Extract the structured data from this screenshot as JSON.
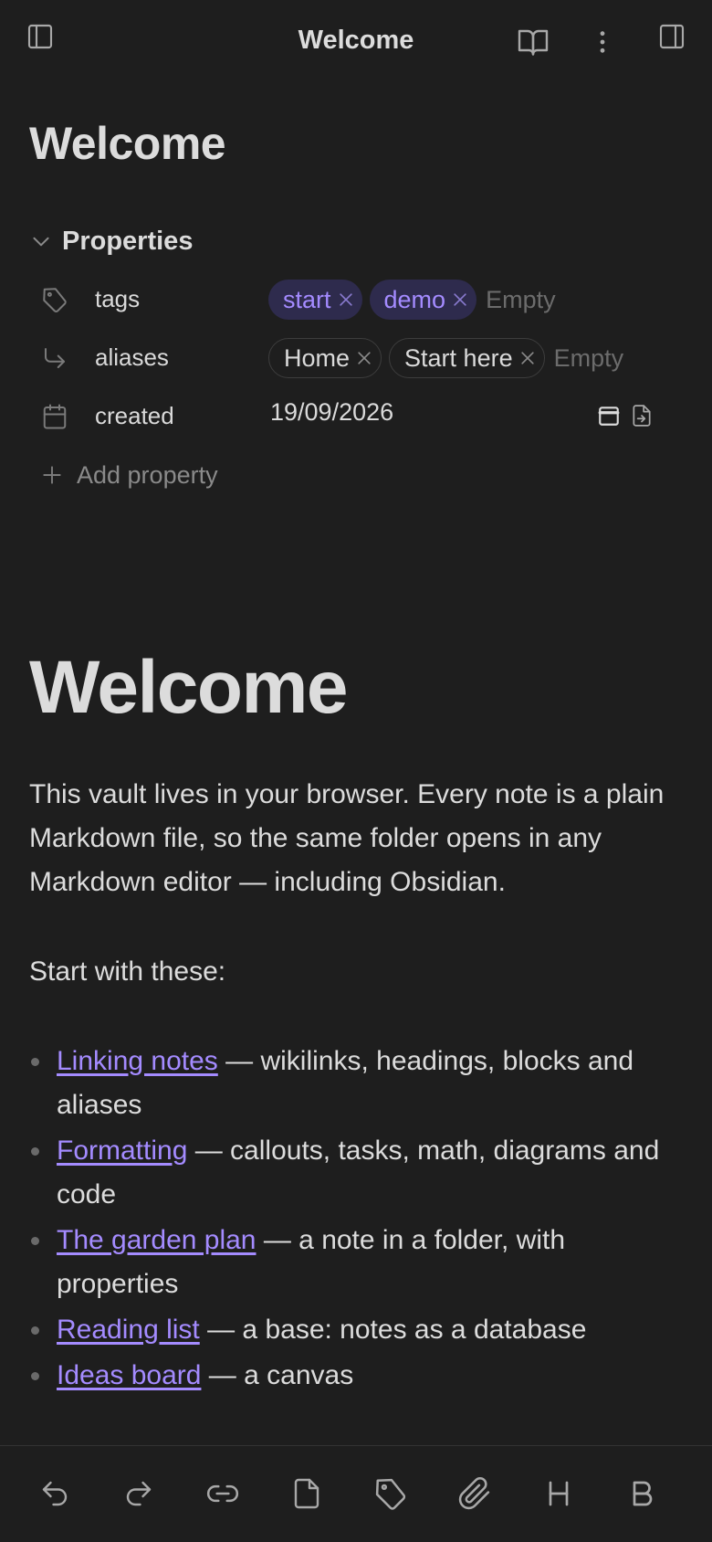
{
  "header": {
    "title": "Welcome",
    "left_icon": "sidebar-left-icon",
    "right_icons": [
      "book-open-icon",
      "more-vertical-icon",
      "sidebar-right-icon"
    ]
  },
  "note": {
    "title": "Welcome"
  },
  "properties": {
    "heading": "Properties",
    "tags": {
      "key": "tags",
      "values": [
        "start",
        "demo"
      ],
      "empty_placeholder": "Empty"
    },
    "aliases": {
      "key": "aliases",
      "values": [
        "Home",
        "Start here"
      ],
      "empty_placeholder": "Empty"
    },
    "created": {
      "key": "created",
      "value": "19/09/2026"
    },
    "add_label": "Add property"
  },
  "body": {
    "heading": "Welcome",
    "intro": "This vault lives in your browser. Every note is a plain Markdown file, so the same folder opens in any Markdown editor — including Obsidian.",
    "start_text": "Start with these:",
    "items": [
      {
        "link": "Linking notes",
        "text": " — wikilinks, headings, blocks and aliases"
      },
      {
        "link": "Formatting",
        "text": " — callouts, tasks, math, diagrams and code"
      },
      {
        "link": "The garden plan",
        "text": " — a note in a folder, with properties"
      },
      {
        "link": "Reading list",
        "text": " — a base: notes as a database"
      },
      {
        "link": "Ideas board",
        "text": " — a canvas"
      }
    ]
  },
  "toolbar": {
    "icons": [
      "undo-icon",
      "redo-icon",
      "link-icon",
      "file-icon",
      "tag-icon",
      "paperclip-icon",
      "heading-icon",
      "bold-icon"
    ]
  },
  "colors": {
    "background": "#1e1e1e",
    "accent": "#a48bff",
    "tag_bg": "#2e2b4d",
    "text": "#dcdcdc",
    "muted": "#6c6c6c"
  }
}
